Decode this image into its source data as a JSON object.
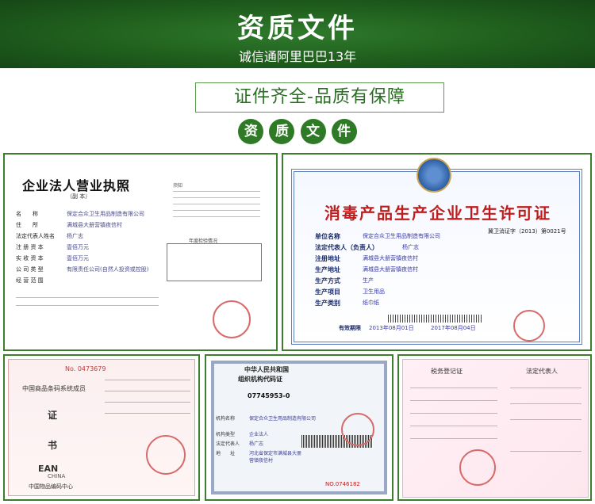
{
  "header": {
    "title": "资质文件",
    "subtitle": "诚信通阿里巴巴13年"
  },
  "slogan": "证件齐全-品质有保障",
  "circles": [
    "资",
    "质",
    "文",
    "件"
  ],
  "colors": {
    "brand_green": "#2f7a26",
    "banner_dark": "#1f5e1d",
    "frame_border": "#3d7e2e",
    "stamp_red": "#c01c1c"
  },
  "cert1": {
    "title": "企业法人营业执照",
    "copy_label": "（副 本）",
    "rows": [
      {
        "label": "名　　称",
        "value": "保定合众卫生用品制造有限公司"
      },
      {
        "label": "住　　所",
        "value": "满城县大册营镇夜信村"
      },
      {
        "label": "法定代表人姓名",
        "value": "杨广志"
      },
      {
        "label": "注 册 资 本",
        "value": "壹佰万元"
      },
      {
        "label": "实 收 资 本",
        "value": "壹佰万元"
      },
      {
        "label": "公 司 类 型",
        "value": "有限责任公司(自然人投资或控股)"
      },
      {
        "label": "经 营 范 围",
        "value": ""
      }
    ],
    "notes_title": "年度检验情况",
    "notice_title": "须知"
  },
  "cert2": {
    "title": "消毒产品生产企业卫生许可证",
    "license_no": "冀卫消证字（2013）第0021号",
    "rows": [
      {
        "label": "单位名称",
        "value": "保定合众卫生用品制造有限公司"
      },
      {
        "label": "法定代表人（负责人）",
        "value": "杨广志"
      },
      {
        "label": "注册地址",
        "value": "满城县大册营镇夜信村"
      },
      {
        "label": "生产地址",
        "value": "满城县大册营镇夜信村"
      },
      {
        "label": "生产方式",
        "value": "生产"
      },
      {
        "label": "生产项目",
        "value": "卫生用品"
      },
      {
        "label": "生产类别",
        "value": "纸巾纸"
      }
    ],
    "validity_label": "有效期限",
    "validity_from": "2013年08月01日",
    "validity_to": "2017年08月04日"
  },
  "cert3": {
    "number": "No. 0473679",
    "org": "中国商品条码系统成员",
    "big1": "证",
    "big2": "书",
    "logo": "EAN",
    "logo_sub": "CHINA",
    "center": "中国物品编码中心"
  },
  "cert4": {
    "head1": "中华人民共和国",
    "head2": "组织机构代码证",
    "code": "07745953-0",
    "rows": [
      {
        "label": "机构名称",
        "value": "保定合众卫生用品制造有限公司"
      },
      {
        "label": "机构类型",
        "value": "企业法人"
      },
      {
        "label": "法定代表人",
        "value": "杨广志"
      },
      {
        "label": "地　　址",
        "value": "河北省保定市满城县大册营镇夜信村"
      }
    ],
    "number": "NO.0746182"
  },
  "cert5": {
    "title": "税务登记证",
    "title2": "法定代表人"
  }
}
